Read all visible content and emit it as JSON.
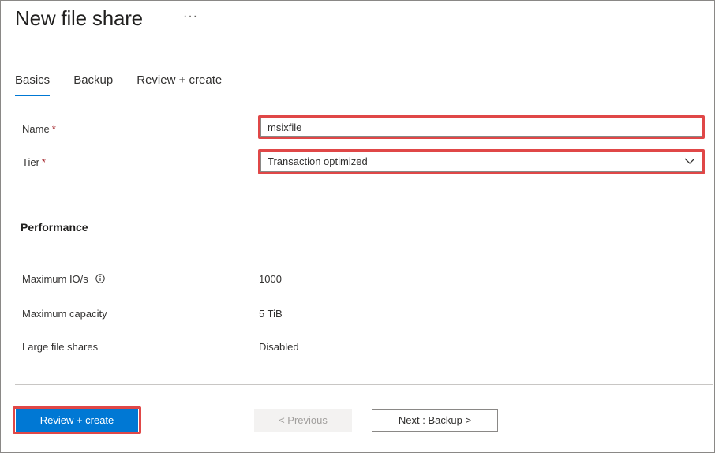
{
  "header": {
    "title": "New file share",
    "more_label": "···"
  },
  "tabs": [
    {
      "label": "Basics",
      "active": true
    },
    {
      "label": "Backup",
      "active": false
    },
    {
      "label": "Review + create",
      "active": false
    }
  ],
  "form": {
    "name_label": "Name",
    "name_value": "msixfile",
    "tier_label": "Tier",
    "tier_value": "Transaction optimized",
    "required_marker": "*"
  },
  "performance": {
    "heading": "Performance",
    "rows": [
      {
        "label": "Maximum IO/s",
        "value": "1000",
        "has_info_icon": true
      },
      {
        "label": "Maximum capacity",
        "value": "5 TiB"
      },
      {
        "label": "Large file shares",
        "value": "Disabled"
      }
    ]
  },
  "footer": {
    "review_create_label": "Review + create",
    "previous_label": "< Previous",
    "next_label": "Next : Backup >"
  },
  "colors": {
    "accent": "#0078d4",
    "highlight": "#e04747",
    "required": "#a4262c"
  },
  "icons": {
    "more": "more-ellipsis-icon",
    "dropdown": "chevron-down-icon",
    "info": "info-icon"
  }
}
